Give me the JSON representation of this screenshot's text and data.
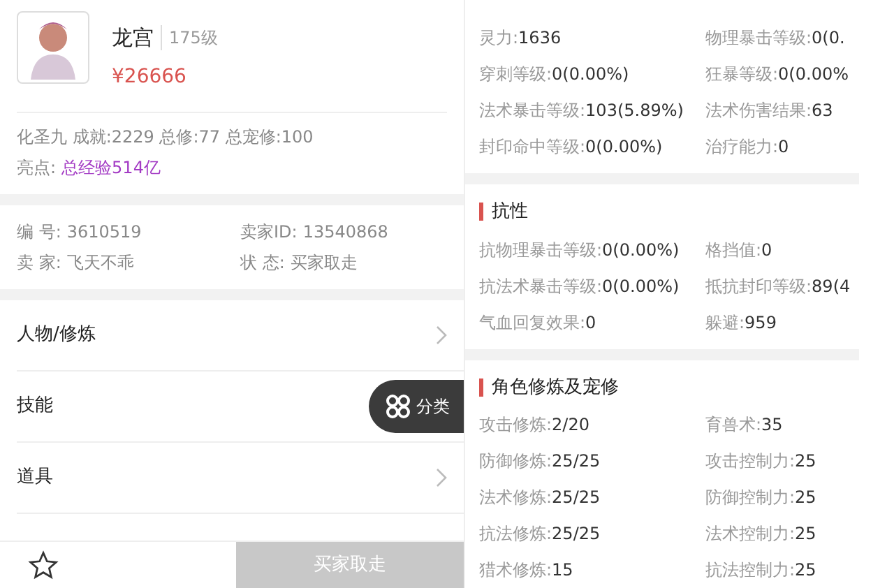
{
  "left": {
    "profile": {
      "name": "龙宫",
      "level": "175级",
      "price": "¥26666"
    },
    "summary": "化圣九 成就:2229 总修:77 总宠修:100",
    "highlight": {
      "label": "亮点:",
      "value": "总经验514亿"
    },
    "info": [
      {
        "label": "编 号:",
        "value": "3610519"
      },
      {
        "label": "卖家ID:",
        "value": "13540868"
      },
      {
        "label": "卖 家:",
        "value": "飞天不乖"
      },
      {
        "label": "状 态:",
        "value": "买家取走"
      }
    ],
    "menu": [
      {
        "label": "人物/修炼",
        "chevron": true
      },
      {
        "label": "技能",
        "chevron": false
      },
      {
        "label": "道具",
        "chevron": true
      }
    ],
    "float_button": {
      "label": "分类"
    },
    "bottom_bar": {
      "action": "买家取走",
      "disabled": true
    }
  },
  "right": {
    "sections": [
      {
        "rows": [
          [
            {
              "label": "灵力:",
              "value": "1636"
            },
            {
              "label": "物理暴击等级:",
              "value": "0(0."
            }
          ],
          [
            {
              "label": "穿刺等级:",
              "value": "0(0.00%)"
            },
            {
              "label": "狂暴等级:",
              "value": "0(0.00%"
            }
          ],
          [
            {
              "label": "法术暴击等级:",
              "value": "103(5.89%)"
            },
            {
              "label": "法术伤害结果:",
              "value": "63"
            }
          ],
          [
            {
              "label": "封印命中等级:",
              "value": "0(0.00%)"
            },
            {
              "label": "治疗能力:",
              "value": "0"
            }
          ]
        ]
      },
      {
        "title": "抗性",
        "rows": [
          [
            {
              "label": "抗物理暴击等级:",
              "value": "0(0.00%)"
            },
            {
              "label": "格挡值:",
              "value": "0"
            }
          ],
          [
            {
              "label": "抗法术暴击等级:",
              "value": "0(0.00%)"
            },
            {
              "label": "抵抗封印等级:",
              "value": "89(4"
            }
          ],
          [
            {
              "label": "气血回复效果:",
              "value": "0"
            },
            {
              "label": "躲避:",
              "value": "959"
            }
          ]
        ]
      },
      {
        "title": "角色修炼及宠修",
        "rows": [
          [
            {
              "label": "攻击修炼:",
              "value": "2/20"
            },
            {
              "label": "育兽术:",
              "value": "35"
            }
          ],
          [
            {
              "label": "防御修炼:",
              "value": "25/25"
            },
            {
              "label": "攻击控制力:",
              "value": "25"
            }
          ],
          [
            {
              "label": "法术修炼:",
              "value": "25/25"
            },
            {
              "label": "防御控制力:",
              "value": "25"
            }
          ],
          [
            {
              "label": "抗法修炼:",
              "value": "25/25"
            },
            {
              "label": "法术控制力:",
              "value": "25"
            }
          ],
          [
            {
              "label": "猎术修炼:",
              "value": "15"
            },
            {
              "label": "抗法控制力:",
              "value": "25"
            }
          ]
        ]
      }
    ]
  }
}
